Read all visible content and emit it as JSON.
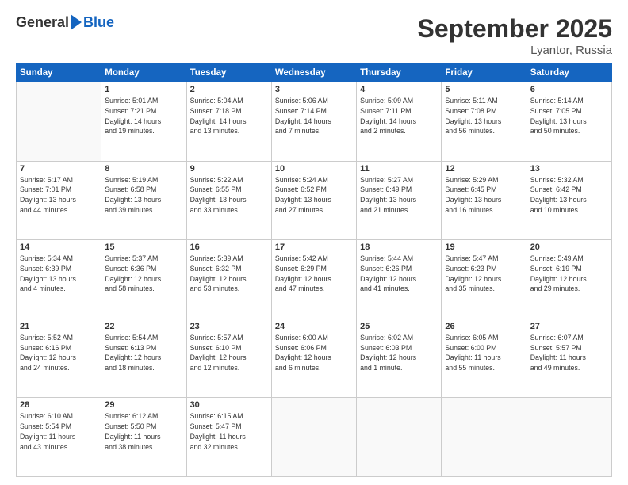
{
  "header": {
    "logo_general": "General",
    "logo_blue": "Blue",
    "month_title": "September 2025",
    "location": "Lyantor, Russia"
  },
  "days_of_week": [
    "Sunday",
    "Monday",
    "Tuesday",
    "Wednesday",
    "Thursday",
    "Friday",
    "Saturday"
  ],
  "weeks": [
    [
      {
        "day": "",
        "info": ""
      },
      {
        "day": "1",
        "info": "Sunrise: 5:01 AM\nSunset: 7:21 PM\nDaylight: 14 hours\nand 19 minutes."
      },
      {
        "day": "2",
        "info": "Sunrise: 5:04 AM\nSunset: 7:18 PM\nDaylight: 14 hours\nand 13 minutes."
      },
      {
        "day": "3",
        "info": "Sunrise: 5:06 AM\nSunset: 7:14 PM\nDaylight: 14 hours\nand 7 minutes."
      },
      {
        "day": "4",
        "info": "Sunrise: 5:09 AM\nSunset: 7:11 PM\nDaylight: 14 hours\nand 2 minutes."
      },
      {
        "day": "5",
        "info": "Sunrise: 5:11 AM\nSunset: 7:08 PM\nDaylight: 13 hours\nand 56 minutes."
      },
      {
        "day": "6",
        "info": "Sunrise: 5:14 AM\nSunset: 7:05 PM\nDaylight: 13 hours\nand 50 minutes."
      }
    ],
    [
      {
        "day": "7",
        "info": "Sunrise: 5:17 AM\nSunset: 7:01 PM\nDaylight: 13 hours\nand 44 minutes."
      },
      {
        "day": "8",
        "info": "Sunrise: 5:19 AM\nSunset: 6:58 PM\nDaylight: 13 hours\nand 39 minutes."
      },
      {
        "day": "9",
        "info": "Sunrise: 5:22 AM\nSunset: 6:55 PM\nDaylight: 13 hours\nand 33 minutes."
      },
      {
        "day": "10",
        "info": "Sunrise: 5:24 AM\nSunset: 6:52 PM\nDaylight: 13 hours\nand 27 minutes."
      },
      {
        "day": "11",
        "info": "Sunrise: 5:27 AM\nSunset: 6:49 PM\nDaylight: 13 hours\nand 21 minutes."
      },
      {
        "day": "12",
        "info": "Sunrise: 5:29 AM\nSunset: 6:45 PM\nDaylight: 13 hours\nand 16 minutes."
      },
      {
        "day": "13",
        "info": "Sunrise: 5:32 AM\nSunset: 6:42 PM\nDaylight: 13 hours\nand 10 minutes."
      }
    ],
    [
      {
        "day": "14",
        "info": "Sunrise: 5:34 AM\nSunset: 6:39 PM\nDaylight: 13 hours\nand 4 minutes."
      },
      {
        "day": "15",
        "info": "Sunrise: 5:37 AM\nSunset: 6:36 PM\nDaylight: 12 hours\nand 58 minutes."
      },
      {
        "day": "16",
        "info": "Sunrise: 5:39 AM\nSunset: 6:32 PM\nDaylight: 12 hours\nand 53 minutes."
      },
      {
        "day": "17",
        "info": "Sunrise: 5:42 AM\nSunset: 6:29 PM\nDaylight: 12 hours\nand 47 minutes."
      },
      {
        "day": "18",
        "info": "Sunrise: 5:44 AM\nSunset: 6:26 PM\nDaylight: 12 hours\nand 41 minutes."
      },
      {
        "day": "19",
        "info": "Sunrise: 5:47 AM\nSunset: 6:23 PM\nDaylight: 12 hours\nand 35 minutes."
      },
      {
        "day": "20",
        "info": "Sunrise: 5:49 AM\nSunset: 6:19 PM\nDaylight: 12 hours\nand 29 minutes."
      }
    ],
    [
      {
        "day": "21",
        "info": "Sunrise: 5:52 AM\nSunset: 6:16 PM\nDaylight: 12 hours\nand 24 minutes."
      },
      {
        "day": "22",
        "info": "Sunrise: 5:54 AM\nSunset: 6:13 PM\nDaylight: 12 hours\nand 18 minutes."
      },
      {
        "day": "23",
        "info": "Sunrise: 5:57 AM\nSunset: 6:10 PM\nDaylight: 12 hours\nand 12 minutes."
      },
      {
        "day": "24",
        "info": "Sunrise: 6:00 AM\nSunset: 6:06 PM\nDaylight: 12 hours\nand 6 minutes."
      },
      {
        "day": "25",
        "info": "Sunrise: 6:02 AM\nSunset: 6:03 PM\nDaylight: 12 hours\nand 1 minute."
      },
      {
        "day": "26",
        "info": "Sunrise: 6:05 AM\nSunset: 6:00 PM\nDaylight: 11 hours\nand 55 minutes."
      },
      {
        "day": "27",
        "info": "Sunrise: 6:07 AM\nSunset: 5:57 PM\nDaylight: 11 hours\nand 49 minutes."
      }
    ],
    [
      {
        "day": "28",
        "info": "Sunrise: 6:10 AM\nSunset: 5:54 PM\nDaylight: 11 hours\nand 43 minutes."
      },
      {
        "day": "29",
        "info": "Sunrise: 6:12 AM\nSunset: 5:50 PM\nDaylight: 11 hours\nand 38 minutes."
      },
      {
        "day": "30",
        "info": "Sunrise: 6:15 AM\nSunset: 5:47 PM\nDaylight: 11 hours\nand 32 minutes."
      },
      {
        "day": "",
        "info": ""
      },
      {
        "day": "",
        "info": ""
      },
      {
        "day": "",
        "info": ""
      },
      {
        "day": "",
        "info": ""
      }
    ]
  ]
}
